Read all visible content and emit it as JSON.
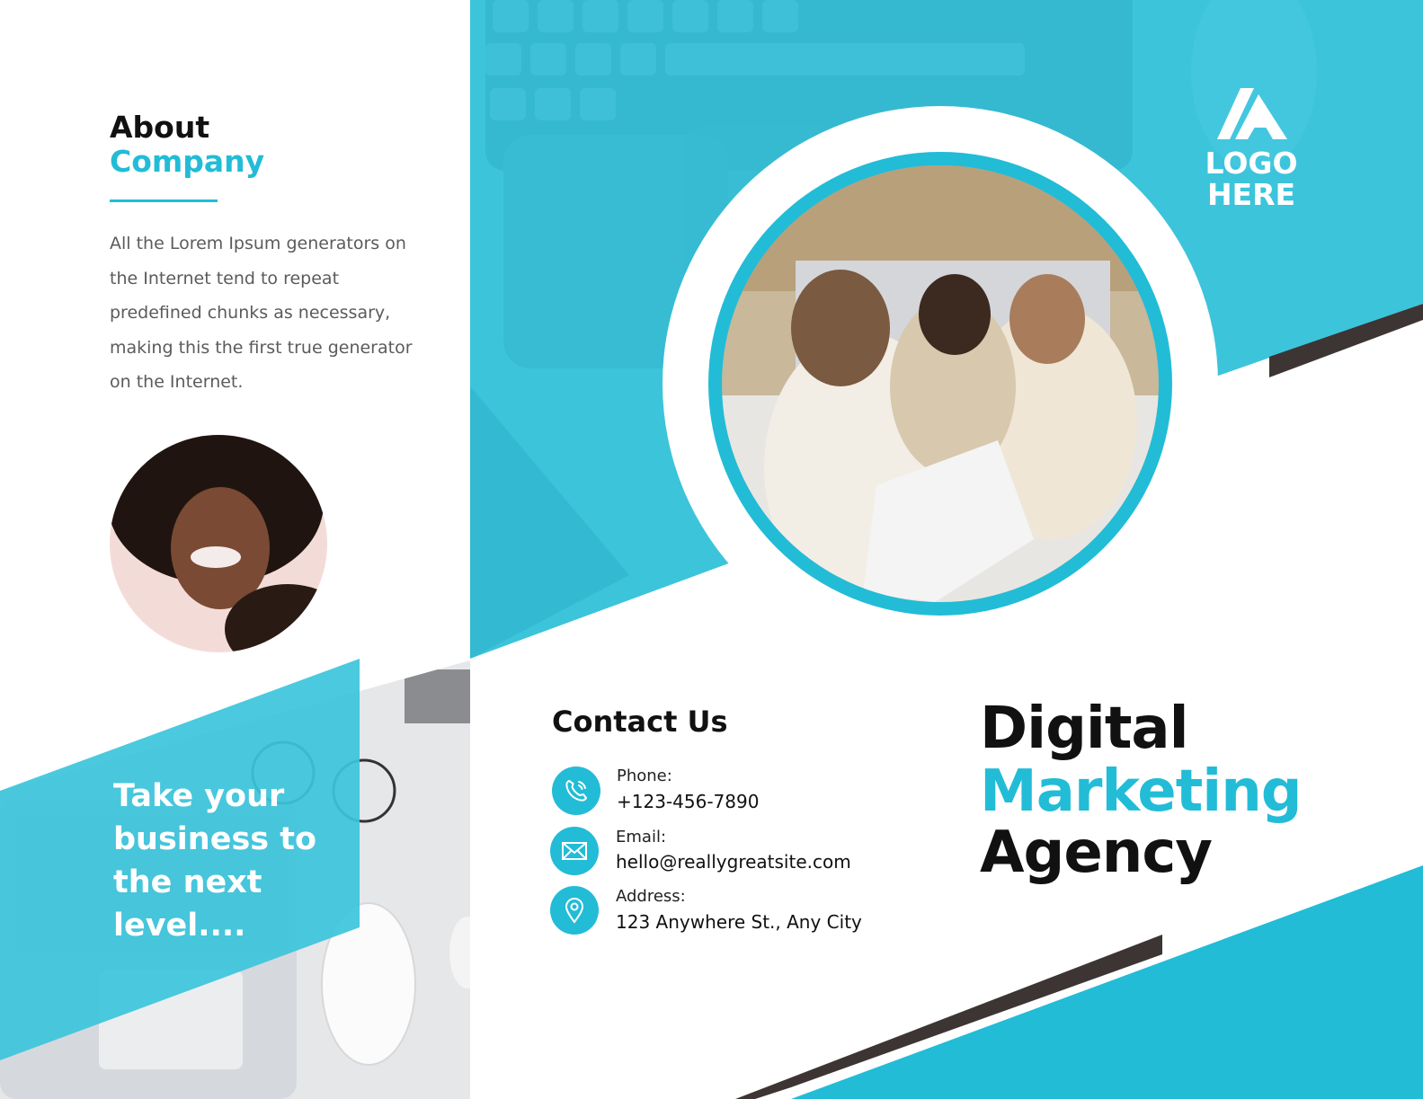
{
  "colors": {
    "accent": "#22bcd7",
    "accent_light": "#3cc4db",
    "dark": "#3c3533",
    "text": "#111111",
    "body_text": "#5b5b5b"
  },
  "about": {
    "title": "About",
    "subtitle": "Company",
    "body": "All the Lorem Ipsum generators on the Internet tend to repeat predefined chunks as necessary, making this the first true generator on the Internet."
  },
  "tagline": "Take your business to the next level....",
  "logo": {
    "icon": "logo-arrow-icon",
    "line1": "LOGO",
    "line2": "HERE"
  },
  "contact": {
    "title": "Contact Us",
    "phone_label": "Phone:",
    "phone_value": "+123-456-7890",
    "email_label": "Email:",
    "email_value": "hello@reallygreatsite.com",
    "address_label": "Address:",
    "address_value": "123 Anywhere St., Any City",
    "icons": [
      "phone-icon",
      "mail-icon",
      "location-pin-icon"
    ]
  },
  "headline": {
    "line1": "Digital",
    "line2": "Marketing",
    "line3": "Agency"
  }
}
